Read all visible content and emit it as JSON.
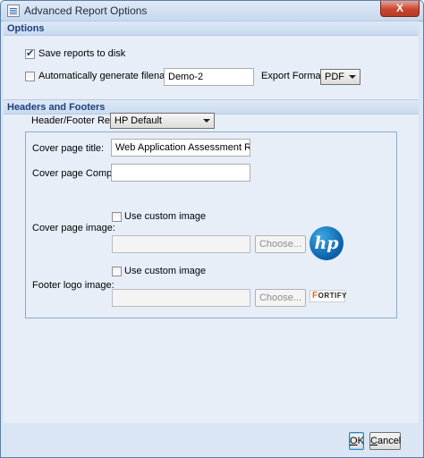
{
  "window": {
    "title": "Advanced Report Options",
    "close_label": "X"
  },
  "options": {
    "header": "Options",
    "save_reports": {
      "label": "Save reports to disk",
      "checked": true
    },
    "auto_filename": {
      "label": "Automatically generate filename",
      "checked": false,
      "value": "Demo-2"
    },
    "export_format": {
      "label": "Export Format:",
      "value": "PDF"
    }
  },
  "headers_footers": {
    "header": "Headers and Footers",
    "report_label": "Header/Footer Report:",
    "report_value": "HP Default",
    "cover_title": {
      "label": "Cover page title:",
      "value": "Web Application Assessment Report"
    },
    "cover_company": {
      "label": "Cover page Company:",
      "value": ""
    },
    "cover_image": {
      "label": "Cover page image:",
      "checkbox_label": "Use custom image",
      "checked": false,
      "choose_label": "Choose...",
      "logo_text": "hp"
    },
    "footer_logo": {
      "label": "Footer logo image:",
      "checkbox_label": "Use custom image",
      "checked": false,
      "choose_label": "Choose...",
      "logo_text": "FORTIFY",
      "logo_initial": "F",
      "logo_rest": "ORTIFY"
    }
  },
  "buttons": {
    "ok_label": "OK",
    "ok_underline": "O",
    "ok_rest": "K",
    "cancel_label": "Cancel",
    "cancel_underline": "C",
    "cancel_rest": "ancel"
  }
}
